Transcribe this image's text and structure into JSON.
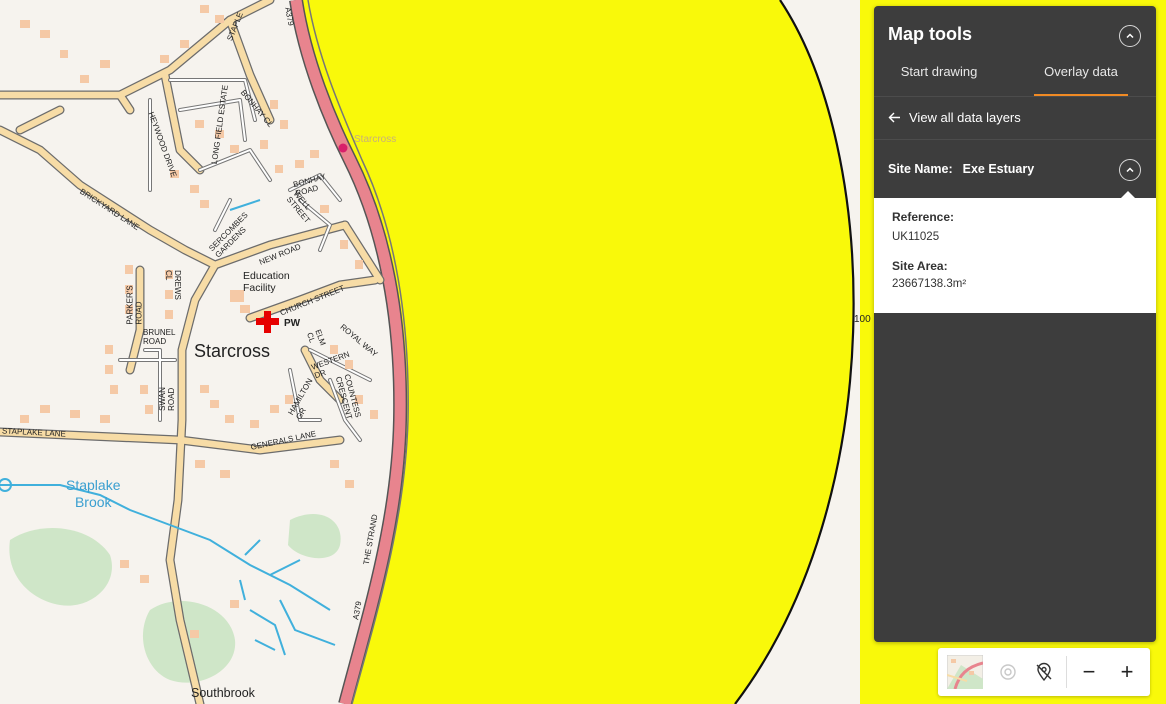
{
  "map": {
    "place_labels": {
      "starcross_town": "Starcross",
      "starcross_station": "Starcross",
      "education_facility": "Education\nFacility",
      "pw": "PW",
      "staplake_brook": "Staplake\nBrook",
      "southbrook": "Southbrook",
      "scale_marker": "100"
    },
    "road_labels": {
      "a379_top": "A379",
      "a379_bottom": "A379",
      "the_strand": "THE STRAND",
      "staple_cl": "STAPLE",
      "long_field_estate": "LONG FIELD ESTATE",
      "bonhay_cl": "BONHAY CL",
      "heywood_drive": "HEYWOOD DRIVE",
      "brickyard_lane": "BRICKYARD LANE",
      "bonhay_road": "BONHAY\nROAD",
      "well_street": "WELL\nSTREET",
      "sercombes_gardens": "SERCOMBES\nGARDENS",
      "new_road": "NEW ROAD",
      "parkers_road": "PARKER'S\nROAD",
      "drews_cl": "DREWS\nCL",
      "brunel_road": "BRUNEL\nROAD",
      "church_street": "CHURCH STREET",
      "royal_way": "ROYAL WAY",
      "elm_cl": "ELM\nCL",
      "western_dr": "WESTERN\nDR",
      "hamilton_gr": "HAMILTON\nGR",
      "countess_crescent": "COUNTESS\nCRESCENT",
      "swan_road": "SWAN\nROAD",
      "staplake_lane": "STAPLAKE LANE",
      "generals_lane": "GENERALS LANE"
    },
    "colors": {
      "overlay": "#f9f90a",
      "a_road": "#e8848e",
      "minor_road": "#f7dca6",
      "building": "#f5c9a6",
      "water": "#40b0dc",
      "woodland": "#cfe6c8",
      "pw_cross": "#e60000",
      "station": "#d81f6a"
    }
  },
  "panel": {
    "title": "Map tools",
    "collapse_icon": "chevron-up-icon",
    "tabs": [
      {
        "label": "Start drawing",
        "active": false
      },
      {
        "label": "Overlay data",
        "active": true
      }
    ],
    "back_link": "View all data layers",
    "site_name_label": "Site Name:",
    "site_name_value": "Exe Estuary",
    "reference_label": "Reference:",
    "reference_value": "UK11025",
    "site_area_label": "Site Area:",
    "site_area_value": "23667138.3m²",
    "accent": "#f08a24"
  },
  "toolbar": {
    "items": [
      "basemap-thumbnail",
      "locate-icon",
      "no-location-icon",
      "zoom-out-icon",
      "zoom-in-icon"
    ],
    "zoom_out": "−",
    "zoom_in": "+"
  }
}
